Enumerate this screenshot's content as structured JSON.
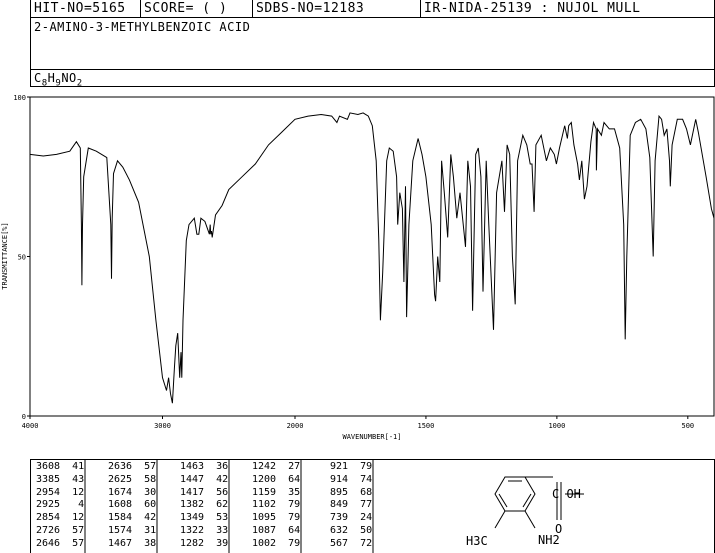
{
  "header": {
    "hit_no": "HIT-NO=5165",
    "score": "SCORE=  (   )",
    "sdbs_no": "SDBS-NO=12183",
    "ir_info": "IR-NIDA-25139 : NUJOL MULL"
  },
  "compound": {
    "name": "2-AMINO-3-METHYLBENZOIC ACID",
    "formula_parts": [
      "C",
      "8",
      "H",
      "9",
      "NO",
      "2"
    ]
  },
  "chart_data": {
    "type": "line",
    "title": "",
    "xlabel": "WAVENUMBER[-1]",
    "ylabel": "TRANSMITTANCE[%]",
    "xlim": [
      4000,
      400
    ],
    "ylim": [
      0,
      100
    ],
    "x_ticks": [
      4000,
      3000,
      2000,
      1500,
      1000,
      500
    ],
    "y_ticks": [
      0,
      50,
      100
    ],
    "series": [
      {
        "points": [
          [
            4000,
            82
          ],
          [
            3900,
            81.5
          ],
          [
            3800,
            82
          ],
          [
            3700,
            83
          ],
          [
            3650,
            86
          ],
          [
            3620,
            84
          ],
          [
            3612,
            60
          ],
          [
            3608,
            41
          ],
          [
            3604,
            60
          ],
          [
            3595,
            75
          ],
          [
            3560,
            84
          ],
          [
            3500,
            83
          ],
          [
            3420,
            81
          ],
          [
            3390,
            60
          ],
          [
            3385,
            43
          ],
          [
            3380,
            62
          ],
          [
            3370,
            76
          ],
          [
            3340,
            80
          ],
          [
            3300,
            78
          ],
          [
            3250,
            74
          ],
          [
            3180,
            67
          ],
          [
            3100,
            50
          ],
          [
            3050,
            30
          ],
          [
            3000,
            12
          ],
          [
            2970,
            8
          ],
          [
            2954,
            12
          ],
          [
            2940,
            7
          ],
          [
            2925,
            4
          ],
          [
            2910,
            15
          ],
          [
            2900,
            22
          ],
          [
            2885,
            26
          ],
          [
            2870,
            12
          ],
          [
            2860,
            20
          ],
          [
            2854,
            12
          ],
          [
            2845,
            30
          ],
          [
            2820,
            55
          ],
          [
            2800,
            60
          ],
          [
            2760,
            62
          ],
          [
            2740,
            57
          ],
          [
            2726,
            57
          ],
          [
            2710,
            62
          ],
          [
            2680,
            61
          ],
          [
            2646,
            57
          ],
          [
            2640,
            60
          ],
          [
            2636,
            57
          ],
          [
            2630,
            58
          ],
          [
            2625,
            56
          ],
          [
            2600,
            63
          ],
          [
            2550,
            66
          ],
          [
            2500,
            71
          ],
          [
            2400,
            75
          ],
          [
            2300,
            79
          ],
          [
            2200,
            85
          ],
          [
            2100,
            89
          ],
          [
            2000,
            93
          ],
          [
            1950,
            94
          ],
          [
            1900,
            94.5
          ],
          [
            1860,
            94
          ],
          [
            1840,
            92
          ],
          [
            1830,
            94
          ],
          [
            1800,
            93
          ],
          [
            1790,
            95
          ],
          [
            1760,
            94.5
          ],
          [
            1740,
            95
          ],
          [
            1720,
            94
          ],
          [
            1705,
            91
          ],
          [
            1690,
            80
          ],
          [
            1680,
            55
          ],
          [
            1674,
            30
          ],
          [
            1665,
            45
          ],
          [
            1650,
            80
          ],
          [
            1640,
            84
          ],
          [
            1625,
            83
          ],
          [
            1612,
            75
          ],
          [
            1608,
            60
          ],
          [
            1600,
            70
          ],
          [
            1590,
            65
          ],
          [
            1584,
            42
          ],
          [
            1578,
            72
          ],
          [
            1574,
            31
          ],
          [
            1565,
            60
          ],
          [
            1550,
            80
          ],
          [
            1530,
            87
          ],
          [
            1515,
            82
          ],
          [
            1500,
            75
          ],
          [
            1480,
            60
          ],
          [
            1467,
            38
          ],
          [
            1463,
            36
          ],
          [
            1455,
            50
          ],
          [
            1447,
            42
          ],
          [
            1440,
            80
          ],
          [
            1430,
            70
          ],
          [
            1417,
            56
          ],
          [
            1405,
            82
          ],
          [
            1395,
            75
          ],
          [
            1382,
            62
          ],
          [
            1370,
            70
          ],
          [
            1349,
            53
          ],
          [
            1340,
            80
          ],
          [
            1330,
            72
          ],
          [
            1322,
            33
          ],
          [
            1310,
            82
          ],
          [
            1300,
            84
          ],
          [
            1290,
            75
          ],
          [
            1282,
            39
          ],
          [
            1270,
            80
          ],
          [
            1260,
            60
          ],
          [
            1242,
            27
          ],
          [
            1230,
            70
          ],
          [
            1210,
            80
          ],
          [
            1200,
            64
          ],
          [
            1190,
            85
          ],
          [
            1180,
            82
          ],
          [
            1170,
            50
          ],
          [
            1159,
            35
          ],
          [
            1150,
            80
          ],
          [
            1130,
            88
          ],
          [
            1115,
            85
          ],
          [
            1102,
            79
          ],
          [
            1095,
            79
          ],
          [
            1087,
            64
          ],
          [
            1080,
            85
          ],
          [
            1060,
            88
          ],
          [
            1040,
            80
          ],
          [
            1025,
            84
          ],
          [
            1010,
            82
          ],
          [
            1002,
            79
          ],
          [
            990,
            84
          ],
          [
            970,
            91
          ],
          [
            960,
            87
          ],
          [
            955,
            91
          ],
          [
            945,
            92
          ],
          [
            935,
            85
          ],
          [
            921,
            79
          ],
          [
            914,
            74
          ],
          [
            905,
            80
          ],
          [
            895,
            68
          ],
          [
            885,
            72
          ],
          [
            870,
            86
          ],
          [
            860,
            92
          ],
          [
            850,
            90
          ],
          [
            849,
            77
          ],
          [
            845,
            90
          ],
          [
            830,
            88
          ],
          [
            820,
            92
          ],
          [
            800,
            90
          ],
          [
            780,
            90
          ],
          [
            760,
            84
          ],
          [
            745,
            60
          ],
          [
            739,
            24
          ],
          [
            733,
            50
          ],
          [
            720,
            88
          ],
          [
            700,
            92
          ],
          [
            680,
            93
          ],
          [
            660,
            90
          ],
          [
            645,
            81
          ],
          [
            632,
            50
          ],
          [
            625,
            80
          ],
          [
            610,
            94
          ],
          [
            600,
            93
          ],
          [
            590,
            88
          ],
          [
            580,
            90
          ],
          [
            570,
            80
          ],
          [
            567,
            72
          ],
          [
            560,
            85
          ],
          [
            540,
            93
          ],
          [
            520,
            93
          ],
          [
            505,
            90
          ],
          [
            490,
            85
          ],
          [
            470,
            93
          ],
          [
            460,
            89
          ],
          [
            430,
            75
          ],
          [
            410,
            65
          ],
          [
            400,
            62
          ]
        ]
      }
    ]
  },
  "peaks": [
    [
      [
        3608,
        41
      ],
      [
        3385,
        43
      ],
      [
        2954,
        12
      ],
      [
        2925,
        4
      ],
      [
        2854,
        12
      ],
      [
        2726,
        57
      ],
      [
        2646,
        57
      ]
    ],
    [
      [
        2636,
        57
      ],
      [
        2625,
        58
      ],
      [
        1674,
        30
      ],
      [
        1608,
        60
      ],
      [
        1584,
        42
      ],
      [
        1574,
        31
      ],
      [
        1467,
        38
      ]
    ],
    [
      [
        1463,
        36
      ],
      [
        1447,
        42
      ],
      [
        1417,
        56
      ],
      [
        1382,
        62
      ],
      [
        1349,
        53
      ],
      [
        1322,
        33
      ],
      [
        1282,
        39
      ]
    ],
    [
      [
        1242,
        27
      ],
      [
        1200,
        64
      ],
      [
        1159,
        35
      ],
      [
        1102,
        79
      ],
      [
        1095,
        79
      ],
      [
        1087,
        64
      ],
      [
        1002,
        79
      ]
    ],
    [
      [
        921,
        79
      ],
      [
        914,
        74
      ],
      [
        895,
        68
      ],
      [
        849,
        77
      ],
      [
        739,
        24
      ],
      [
        632,
        50
      ],
      [
        567,
        72
      ]
    ]
  ],
  "structure": {
    "cooh_label": "C    OH",
    "o_label": "O",
    "nh2_label": "NH2",
    "ch3_label": "H3C"
  }
}
